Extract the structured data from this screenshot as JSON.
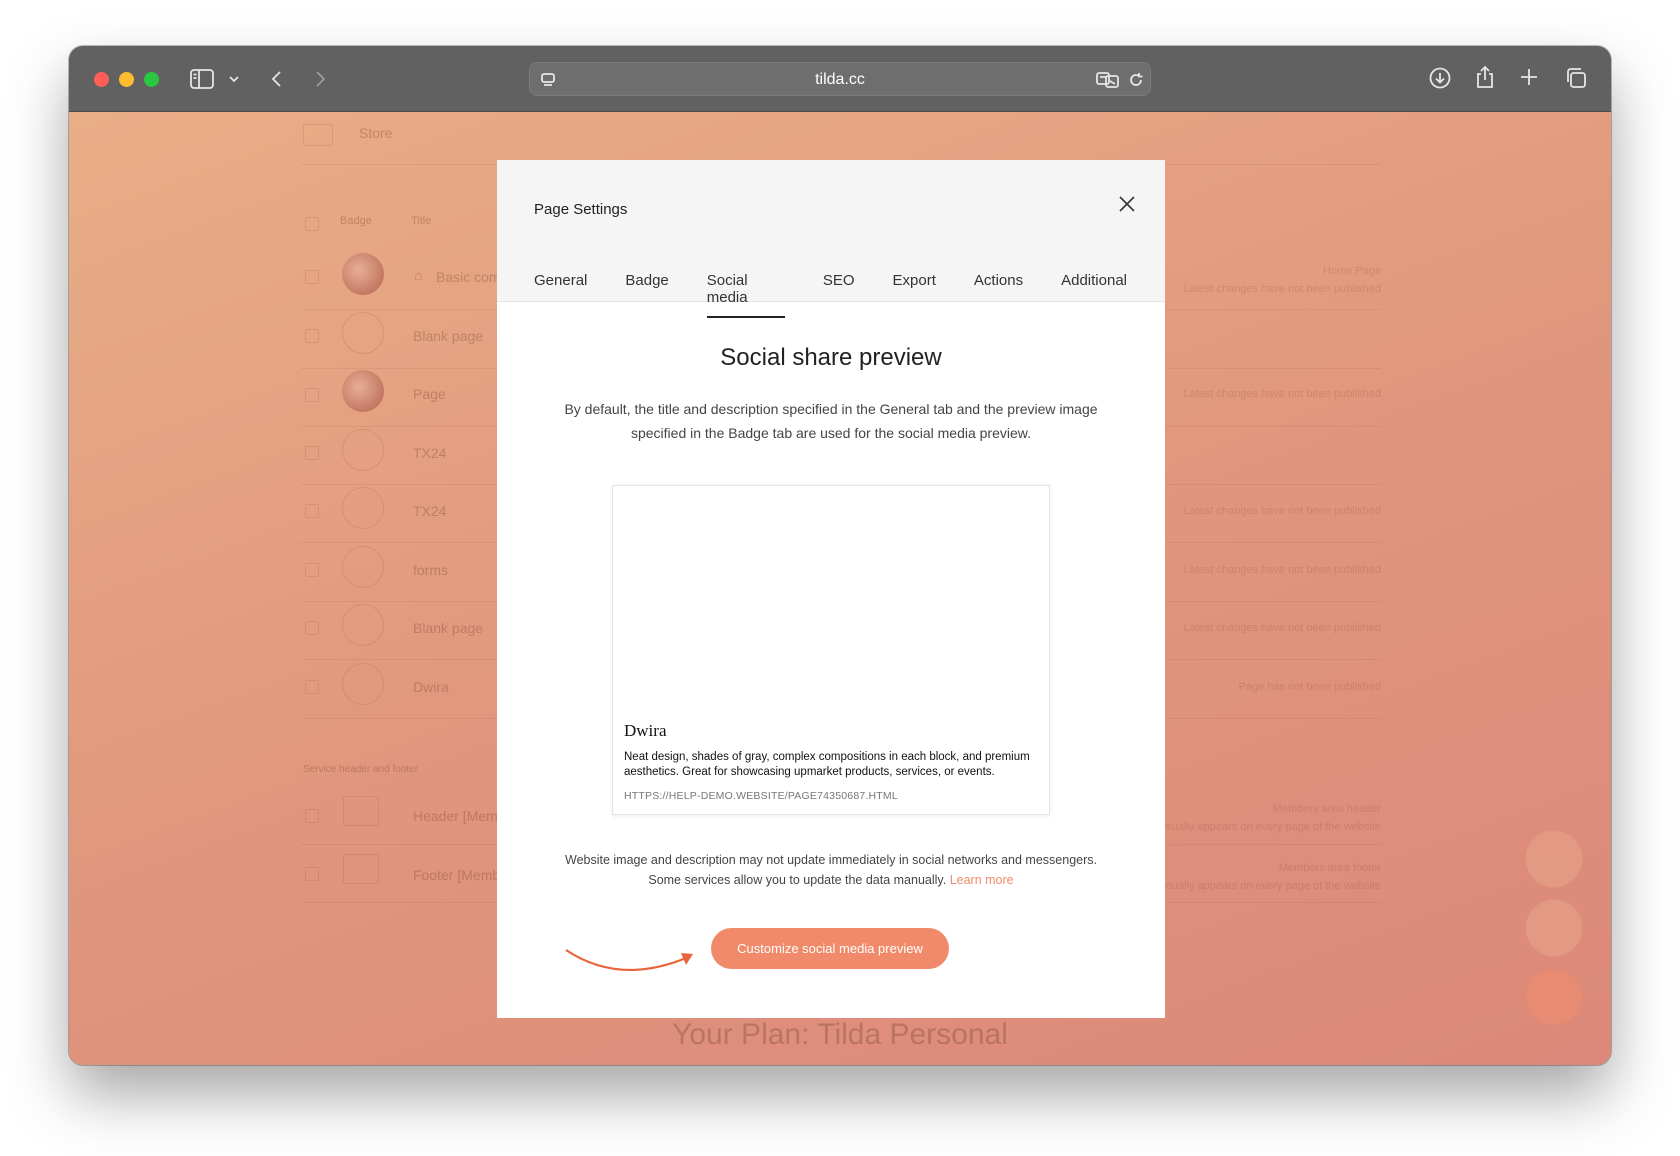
{
  "browser": {
    "address": "tilda.cc"
  },
  "background": {
    "store_label": "Store",
    "col_badge": "Badge",
    "col_title": "Title",
    "rows": [
      {
        "title": "Basic com",
        "status": "Home Page\nLatest changes have not been published"
      },
      {
        "title": "Blank page",
        "status": ""
      },
      {
        "title": "Page",
        "status": "Latest changes have not been published"
      },
      {
        "title": "TX24",
        "status": ""
      },
      {
        "title": "TX24",
        "status": "Latest changes have not been published"
      },
      {
        "title": "forms",
        "status": "Latest changes have not been published"
      },
      {
        "title": "Blank page",
        "status": "Latest changes have not been published"
      },
      {
        "title": "Dwira",
        "status": "Page has not been published"
      }
    ],
    "section_label": "Service header and footer",
    "special_rows": [
      {
        "title": "Header [Mem",
        "status": "Members area header\nusually appears on every page of the website"
      },
      {
        "title": "Footer [Memb",
        "status": "Members area footer\nusually appears on every page of the website"
      }
    ],
    "plan": "Your Plan: Tilda Personal"
  },
  "modal": {
    "title": "Page Settings",
    "tabs": [
      "General",
      "Badge",
      "Social media",
      "SEO",
      "Export",
      "Actions",
      "Additional"
    ],
    "active_tab": "Social media",
    "section_title": "Social share preview",
    "intro": "By default, the title and description specified in the General tab and the preview image specified in the Badge tab are used for the social media preview.",
    "preview": {
      "title": "Dwira",
      "description": "Neat design, shades of gray, complex compositions in each block, and premium aesthetics. Great for showcasing upmarket products, services, or events.",
      "url": "HTTPS://HELP-DEMO.WEBSITE/PAGE74350687.HTML"
    },
    "note": "Website image and description may not update immediately in social networks and messengers. Some services allow you to update the data manually.",
    "learn_more": "Learn more",
    "cta": "Customize social media preview"
  },
  "colors": {
    "accent": "#f08a6a",
    "titlebar": "#616161"
  }
}
